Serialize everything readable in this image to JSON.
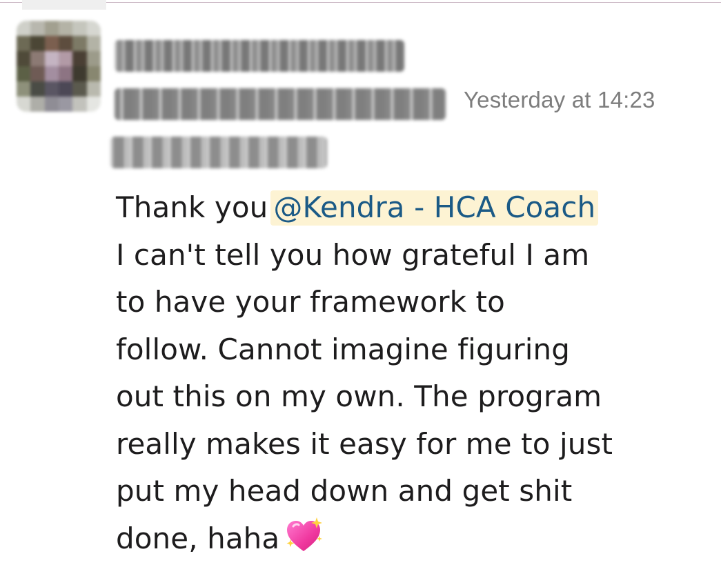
{
  "message": {
    "sender_name": "",
    "timestamp": "Yesterday at 14:23",
    "lines": {
      "line1_prefix": "Thank you",
      "mention": "@Kendra - HCA Coach",
      "line2": "I can't tell you how grateful I am",
      "line3": "to have your framework to",
      "line4": "follow. Cannot imagine figuring",
      "line5": "out this on my own. The program",
      "line6": "really makes it easy for me to just",
      "line7": "put my head down and get shit",
      "line8": "done, haha"
    },
    "emoji": "sparkling-heart-icon"
  },
  "colors": {
    "mention_background": "#fdf3d3",
    "mention_text": "#1b5a86",
    "timestamp_text": "#7d7d7d",
    "body_text": "#1d1c1d"
  }
}
